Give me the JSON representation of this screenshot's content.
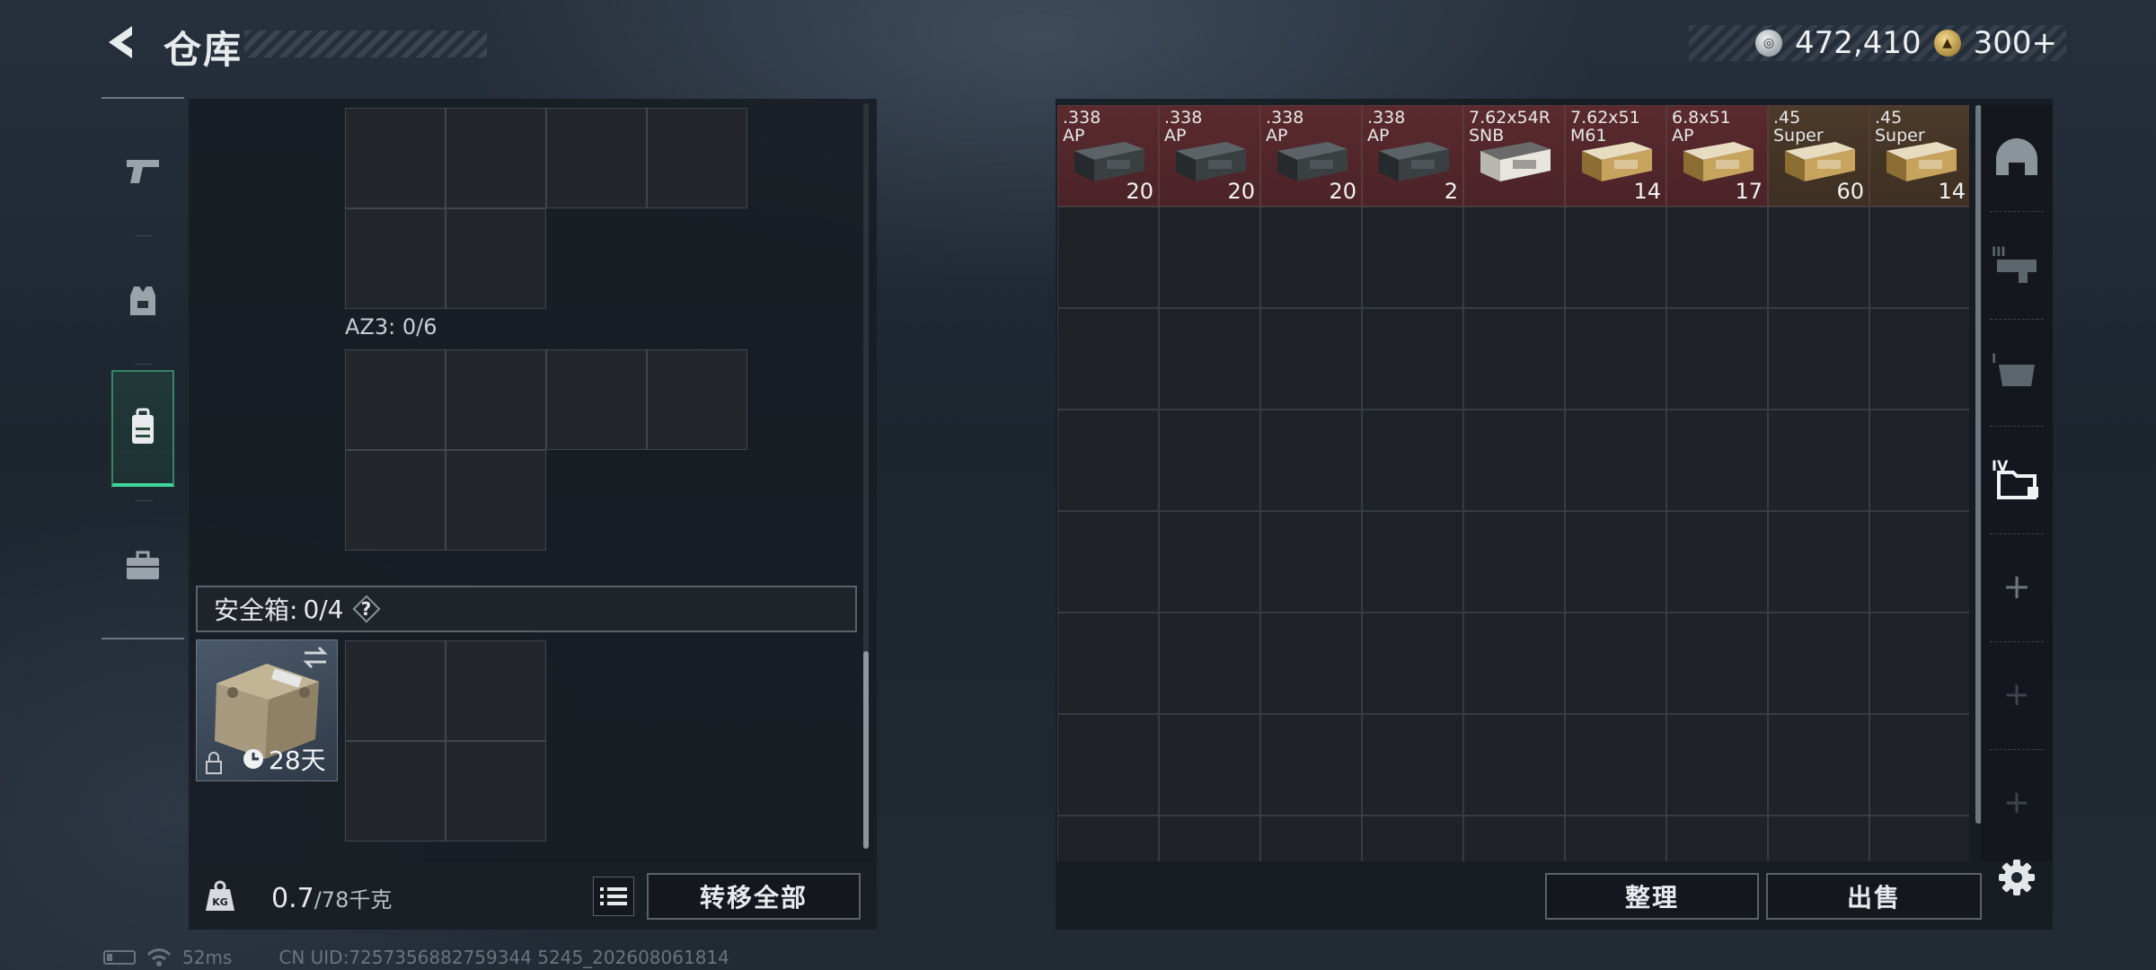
{
  "header": {
    "title": "仓库",
    "currencies": [
      {
        "icon": "silver-coin-icon",
        "value": "472,410"
      },
      {
        "icon": "gold-coin-icon",
        "value": "300+"
      }
    ]
  },
  "left_rail": {
    "items": [
      {
        "name": "weapons",
        "icon": "pistol-icon"
      },
      {
        "name": "armor",
        "icon": "vest-icon"
      },
      {
        "name": "backpack",
        "icon": "backpack-icon",
        "active": true
      },
      {
        "name": "case",
        "icon": "briefcase-icon"
      }
    ]
  },
  "left_panel": {
    "container_label": "AZ3: 0/6",
    "safebox_label": "安全箱:",
    "safebox_count": "0/4",
    "safebox_help": "?",
    "safebox_days": "28天",
    "weight_current": "0.7",
    "weight_max": "/78千克",
    "transfer_all_label": "转移全部"
  },
  "stash": {
    "items": [
      {
        "name": ".338\nAP",
        "count": "20",
        "bg": "red",
        "box": "dark"
      },
      {
        "name": ".338\nAP",
        "count": "20",
        "bg": "red",
        "box": "dark"
      },
      {
        "name": ".338\nAP",
        "count": "20",
        "bg": "red",
        "box": "dark"
      },
      {
        "name": ".338\nAP",
        "count": "2",
        "bg": "red",
        "box": "dark"
      },
      {
        "name": "7.62x54R\nSNB",
        "count": "",
        "bg": "red",
        "box": "white"
      },
      {
        "name": "7.62x51\nM61",
        "count": "14",
        "bg": "red",
        "box": "tan"
      },
      {
        "name": "6.8x51\nAP",
        "count": "17",
        "bg": "red",
        "box": "tan"
      },
      {
        "name": ".45\nSuper",
        "count": "60",
        "bg": "brown",
        "box": "tan"
      },
      {
        "name": ".45\nSuper",
        "count": "14",
        "bg": "brown",
        "box": "tan"
      }
    ],
    "organize_label": "整理",
    "sell_label": "出售"
  },
  "side_tabs": [
    {
      "icon": "helmet-icon"
    },
    {
      "icon": "armored-rig-icon"
    },
    {
      "icon": "rig-icon"
    },
    {
      "icon": "stash-folder-icon",
      "active": true
    },
    {
      "icon": "plus-icon"
    },
    {
      "icon": "plus-icon"
    },
    {
      "icon": "plus-icon"
    }
  ],
  "status": {
    "ping": "52ms",
    "uid": "CN UID:7257356882759344 5245_202608061814"
  },
  "colors": {
    "accent_green": "#3ed59a",
    "ammo_red_bg": "#5a2a2e",
    "ammo_brown_bg": "#4c3a2a"
  }
}
